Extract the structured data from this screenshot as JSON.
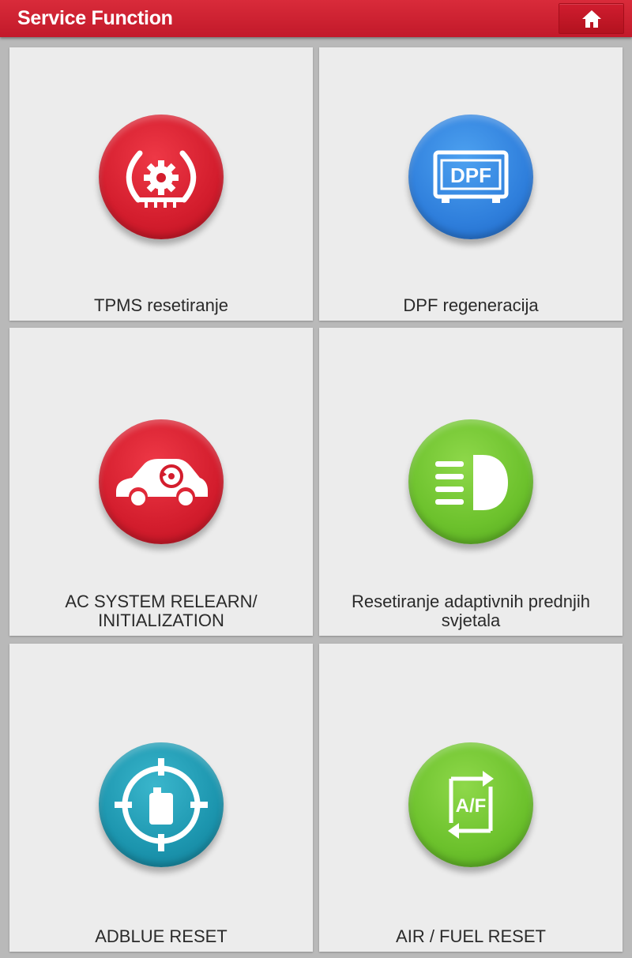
{
  "header": {
    "title": "Service Function",
    "home_icon": "home-icon"
  },
  "tiles": [
    {
      "label": "TPMS resetiranje",
      "icon": "tpms-gear-icon",
      "color": "#d31d2d"
    },
    {
      "label": "DPF regeneracija",
      "icon": "dpf-icon",
      "icon_text": "DPF",
      "color": "#2f7fdc"
    },
    {
      "label": "AC SYSTEM RELEARN/\nINITIALIZATION",
      "icon": "car-relearn-icon",
      "color": "#d31d2d"
    },
    {
      "label": "Resetiranje adaptivnih prednjih\nsvjetala",
      "icon": "headlight-icon",
      "color": "#6cc12c"
    },
    {
      "label": "ADBLUE RESET",
      "icon": "adblue-target-icon",
      "color": "#1c95ae"
    },
    {
      "label": "AIR / FUEL RESET",
      "icon": "air-fuel-icon",
      "icon_text": "A/F",
      "color": "#6cc12c"
    }
  ]
}
